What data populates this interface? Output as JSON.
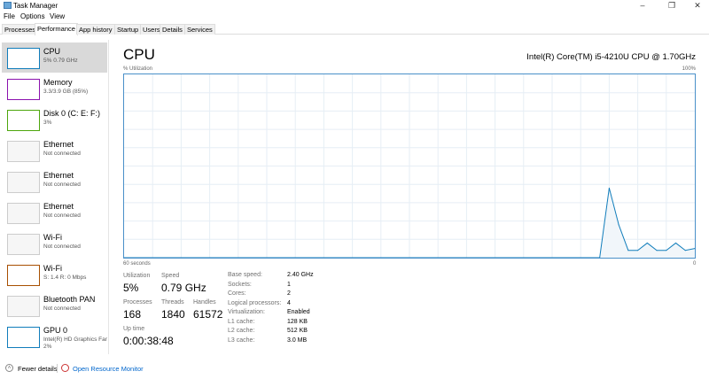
{
  "window": {
    "title": "Task Manager",
    "controls": {
      "minimize": "–",
      "maximize": "❐",
      "close": "✕"
    }
  },
  "menu": [
    "File",
    "Options",
    "View"
  ],
  "tabs": [
    {
      "label": "Processes"
    },
    {
      "label": "Performance",
      "active": true
    },
    {
      "label": "App history"
    },
    {
      "label": "Startup"
    },
    {
      "label": "Users"
    },
    {
      "label": "Details"
    },
    {
      "label": "Services"
    }
  ],
  "sidebar": {
    "items": [
      {
        "name": "CPU",
        "sub": "5% 0.79 GHz",
        "color": "#117dbb",
        "active": true
      },
      {
        "name": "Memory",
        "sub": "3.3/3.9 GB (85%)",
        "color": "#8b12ae"
      },
      {
        "name": "Disk 0 (C: E: F:)",
        "sub": "3%",
        "color": "#4da60c"
      },
      {
        "name": "Ethernet",
        "sub": "Not connected"
      },
      {
        "name": "Ethernet",
        "sub": "Not connected"
      },
      {
        "name": "Ethernet",
        "sub": "Not connected"
      },
      {
        "name": "Wi-Fi",
        "sub": "Not connected"
      },
      {
        "name": "Wi-Fi",
        "sub": "S: 1.4  R: 0 Mbps",
        "color": "#a74f01"
      },
      {
        "name": "Bluetooth PAN",
        "sub": "Not connected"
      },
      {
        "name": "GPU 0",
        "sub": "Intel(R) HD Graphics Far",
        "sub2": "2%",
        "color": "#117dbb"
      }
    ]
  },
  "main": {
    "title": "CPU",
    "cpu_name": "Intel(R) Core(TM) i5-4210U CPU @ 1.70GHz",
    "y_label": "% Utilization",
    "y_max_label": "100%",
    "x_left_label": "60 seconds",
    "x_right_label": "0",
    "stats": {
      "utilization_label": "Utilization",
      "utilization": "5%",
      "speed_label": "Speed",
      "speed": "0.79 GHz",
      "processes_label": "Processes",
      "processes": "168",
      "threads_label": "Threads",
      "threads": "1840",
      "handles_label": "Handles",
      "handles": "61572",
      "uptime_label": "Up time",
      "uptime": "0:00:38:48"
    },
    "specs": [
      [
        "Base speed:",
        "2.40 GHz"
      ],
      [
        "Sockets:",
        "1"
      ],
      [
        "Cores:",
        "2"
      ],
      [
        "Logical processors:",
        "4"
      ],
      [
        "Virtualization:",
        "Enabled"
      ],
      [
        "L1 cache:",
        "128 KB"
      ],
      [
        "L2 cache:",
        "512 KB"
      ],
      [
        "L3 cache:",
        "3.0 MB"
      ]
    ]
  },
  "chart_data": {
    "type": "area",
    "xlabel": "60 seconds",
    "ylabel": "% Utilization",
    "xlim": [
      60,
      0
    ],
    "ylim": [
      0,
      100
    ],
    "grid": true,
    "color": "#117dbb",
    "x_seconds_ago": [
      10,
      9,
      8,
      7,
      6,
      5,
      4,
      3,
      2,
      1,
      0
    ],
    "values": [
      0,
      38,
      18,
      4,
      4,
      8,
      4,
      4,
      8,
      4,
      5
    ]
  },
  "footer": {
    "fewer_details": "Fewer details",
    "open_resource_monitor": "Open Resource Monitor"
  }
}
